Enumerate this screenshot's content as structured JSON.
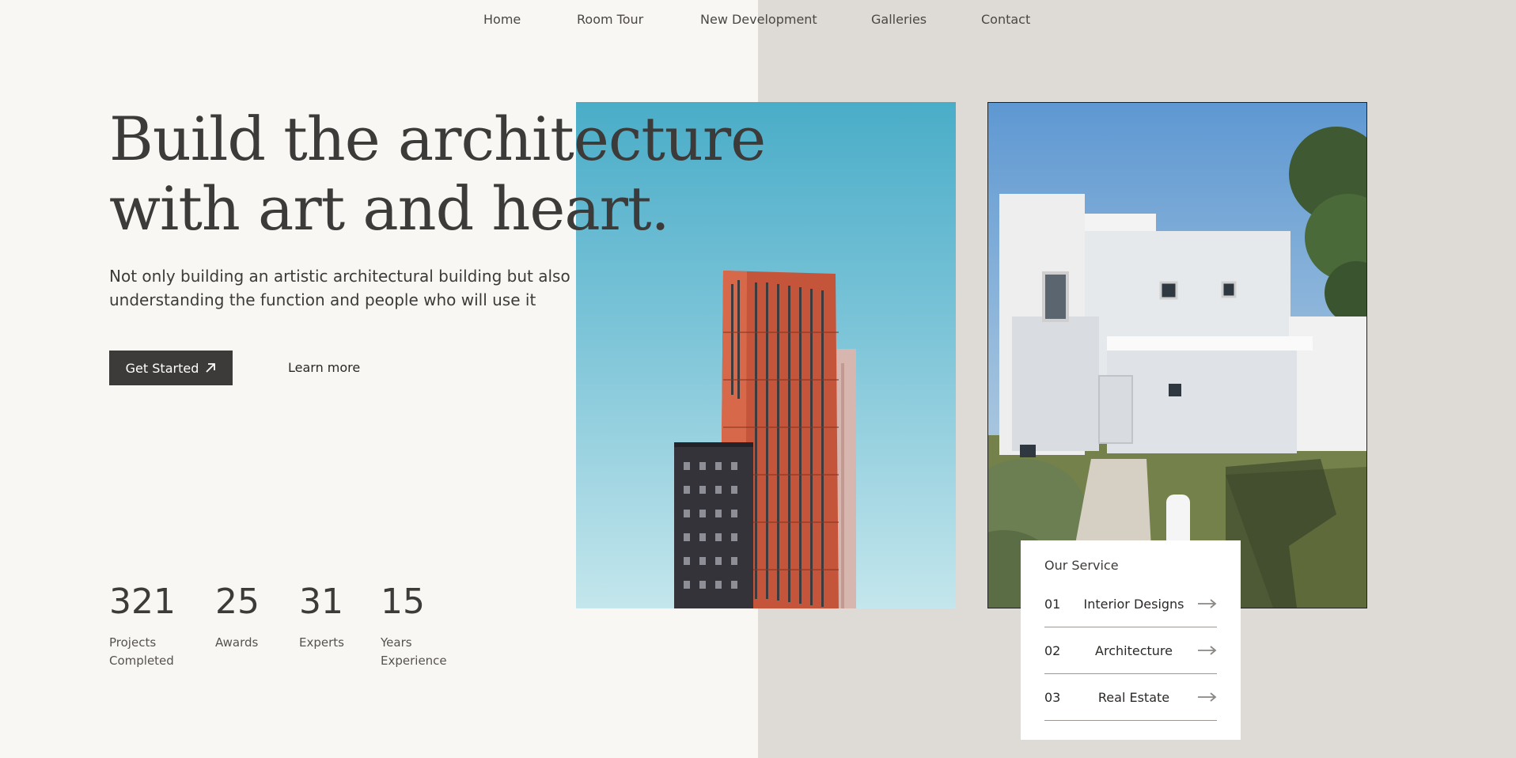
{
  "nav": {
    "items": [
      {
        "label": "Home"
      },
      {
        "label": "Room Tour"
      },
      {
        "label": "New Development"
      },
      {
        "label": "Galleries"
      },
      {
        "label": "Contact"
      }
    ]
  },
  "hero": {
    "title_line1": "Build the architecture",
    "title_line2": "with art and heart.",
    "subtitle": "Not only building an artistic architectural building but also understanding the function and people who will use it",
    "primary_button": "Get Started",
    "secondary_button": "Learn more"
  },
  "stats": [
    {
      "value": "321",
      "label_line1": "Projects",
      "label_line2": "Completed"
    },
    {
      "value": "25",
      "label_line1": "Awards",
      "label_line2": ""
    },
    {
      "value": "31",
      "label_line1": "Experts",
      "label_line2": ""
    },
    {
      "value": "15",
      "label_line1": "Years",
      "label_line2": "Experience"
    }
  ],
  "services": {
    "title": "Our Service",
    "items": [
      {
        "num": "01",
        "name": "Interior Designs"
      },
      {
        "num": "02",
        "name": "Architecture"
      },
      {
        "num": "03",
        "name": "Real Estate"
      }
    ]
  },
  "icons": {
    "get_started": "arrow-up-right-icon",
    "service_arrow": "arrow-right-icon"
  },
  "colors": {
    "left_background": "#f9f7f3",
    "right_background": "#dedbd6",
    "text": "#3d3b39",
    "button": "#3d3b39"
  }
}
